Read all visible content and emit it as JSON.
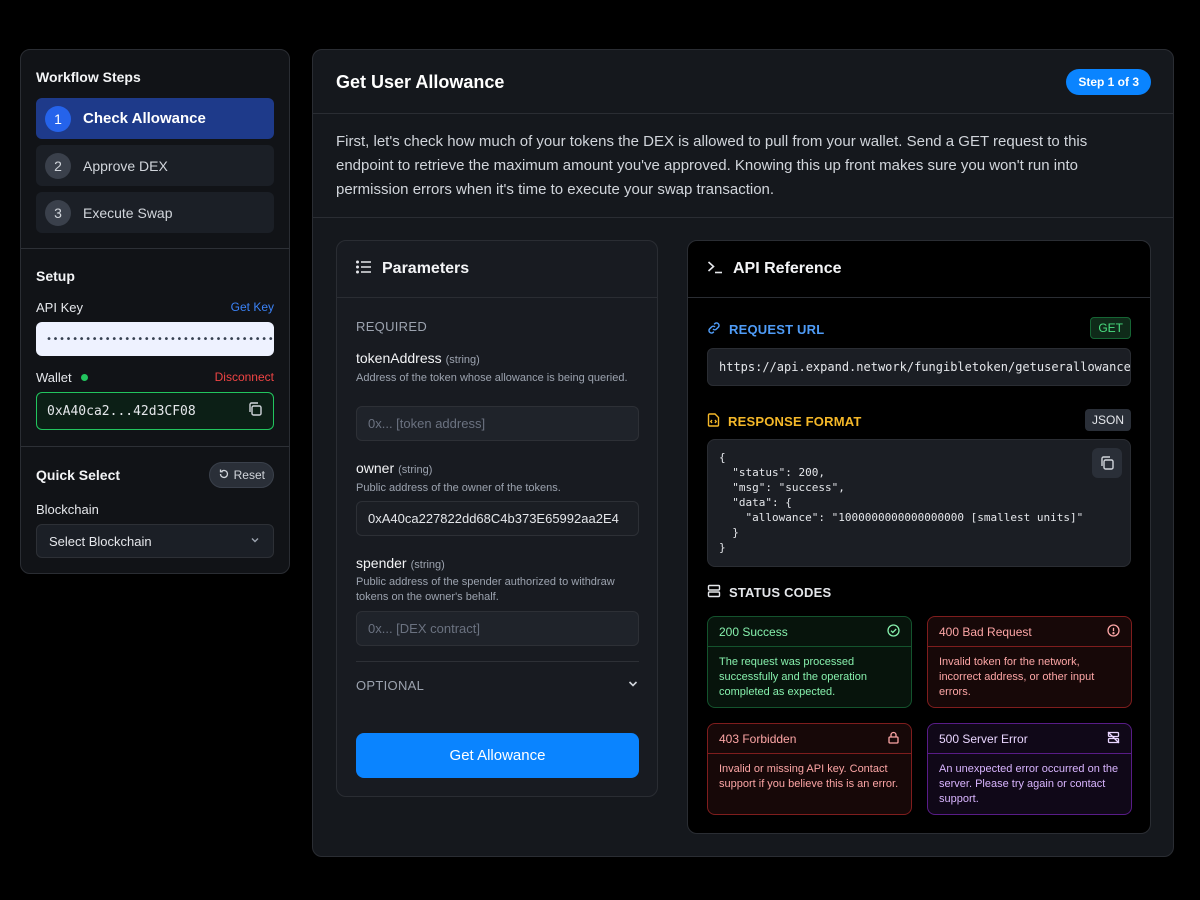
{
  "sidebar": {
    "title": "Workflow Steps",
    "steps": [
      {
        "num": "1",
        "label": "Check Allowance"
      },
      {
        "num": "2",
        "label": "Approve DEX"
      },
      {
        "num": "3",
        "label": "Execute Swap"
      }
    ],
    "setup": {
      "title": "Setup",
      "api_key_label": "API Key",
      "get_key_link": "Get Key",
      "api_key_value": "••••••••••••••••••••••••••••••••••••••••",
      "wallet_label": "Wallet",
      "disconnect_link": "Disconnect",
      "wallet_value": "0xA40ca2...42d3CF08"
    },
    "quick_select": {
      "title": "Quick Select",
      "reset_label": "Reset",
      "blockchain_label": "Blockchain",
      "blockchain_value": "Select Blockchain"
    }
  },
  "main": {
    "title": "Get User Allowance",
    "step_badge": "Step 1 of 3",
    "intro": "First, let's check how much of your tokens the DEX is allowed to pull from your wallet. Send a GET request to this endpoint to retrieve the maximum amount you've approved. Knowing this up front makes sure you won't run into permission errors when it's time to execute your swap transaction."
  },
  "parameters": {
    "title": "Parameters",
    "required_label": "REQUIRED",
    "optional_label": "OPTIONAL",
    "fields": [
      {
        "name": "tokenAddress",
        "type": "(string)",
        "desc": "Address of the token whose allowance is being queried.",
        "placeholder": "0x... [token address]",
        "value": ""
      },
      {
        "name": "owner",
        "type": "(string)",
        "desc": "Public address of the owner of the tokens.",
        "placeholder": "",
        "value": "0xA40ca227822dd68C4b373E65992aa2E4"
      },
      {
        "name": "spender",
        "type": "(string)",
        "desc": "Public address of the spender authorized to withdraw tokens on the owner's behalf.",
        "placeholder": "0x... [DEX contract]",
        "value": ""
      }
    ],
    "submit_label": "Get Allowance"
  },
  "api_reference": {
    "title": "API Reference",
    "request_url_label": "REQUEST URL",
    "method": "GET",
    "url": "https://api.expand.network/fungibletoken/getuserallowance",
    "response_format_label": "RESPONSE FORMAT",
    "format": "JSON",
    "response_json": "{\n  \"status\": 200,\n  \"msg\": \"success\",\n  \"data\": {\n    \"allowance\": \"1000000000000000000 [smallest units]\"\n  }\n}",
    "status_codes_label": "STATUS CODES",
    "status_codes": [
      {
        "title": "200 Success",
        "desc": "The request was processed successfully and the operation completed as expected."
      },
      {
        "title": "400 Bad Request",
        "desc": "Invalid token for the network, incorrect address, or other input errors."
      },
      {
        "title": "403 Forbidden",
        "desc": "Invalid or missing API key. Contact support if you believe this is an error."
      },
      {
        "title": "500 Server Error",
        "desc": "An unexpected error occurred on the server. Please try again or contact support."
      }
    ]
  },
  "colors": {
    "accent": "#0a84ff",
    "active_step": "#1e3a8a",
    "success": "#22c55e",
    "error": "#ef4444",
    "warning": "#f5b829",
    "link": "#3b82f6"
  }
}
